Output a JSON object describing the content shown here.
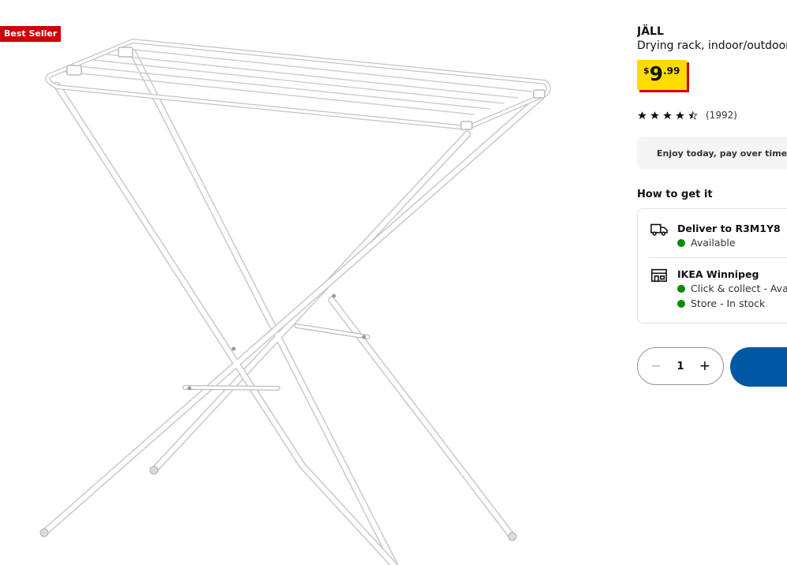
{
  "badge": {
    "label": "Best Seller"
  },
  "product": {
    "name": "JÄLL",
    "description": "Drying rack, indoor/outdoor,",
    "price": {
      "currency": "$",
      "integer": "9",
      "decimal": ".99"
    },
    "rating": {
      "stars": 4.5,
      "count": "(1992)"
    }
  },
  "promo": {
    "text": "Enjoy today, pay over time w"
  },
  "how_to_get": {
    "title": "How to get it",
    "delivery": {
      "title": "Deliver to R3M1Y8",
      "status": "Available"
    },
    "store": {
      "title": "IKEA Winnipeg",
      "lines": [
        "Click & collect - Availa",
        "Store - In stock"
      ]
    }
  },
  "quantity": {
    "value": "1",
    "minus": "−",
    "plus": "+"
  },
  "colors": {
    "badge": "#cc0008",
    "price_bg": "#ffdb00",
    "price_shadow": "#cc0008",
    "status": "#0a8a00",
    "primary": "#0058a3"
  },
  "icons": {
    "delivery": "truck-icon",
    "store": "store-icon",
    "promo": "shopping-bag-icon"
  }
}
